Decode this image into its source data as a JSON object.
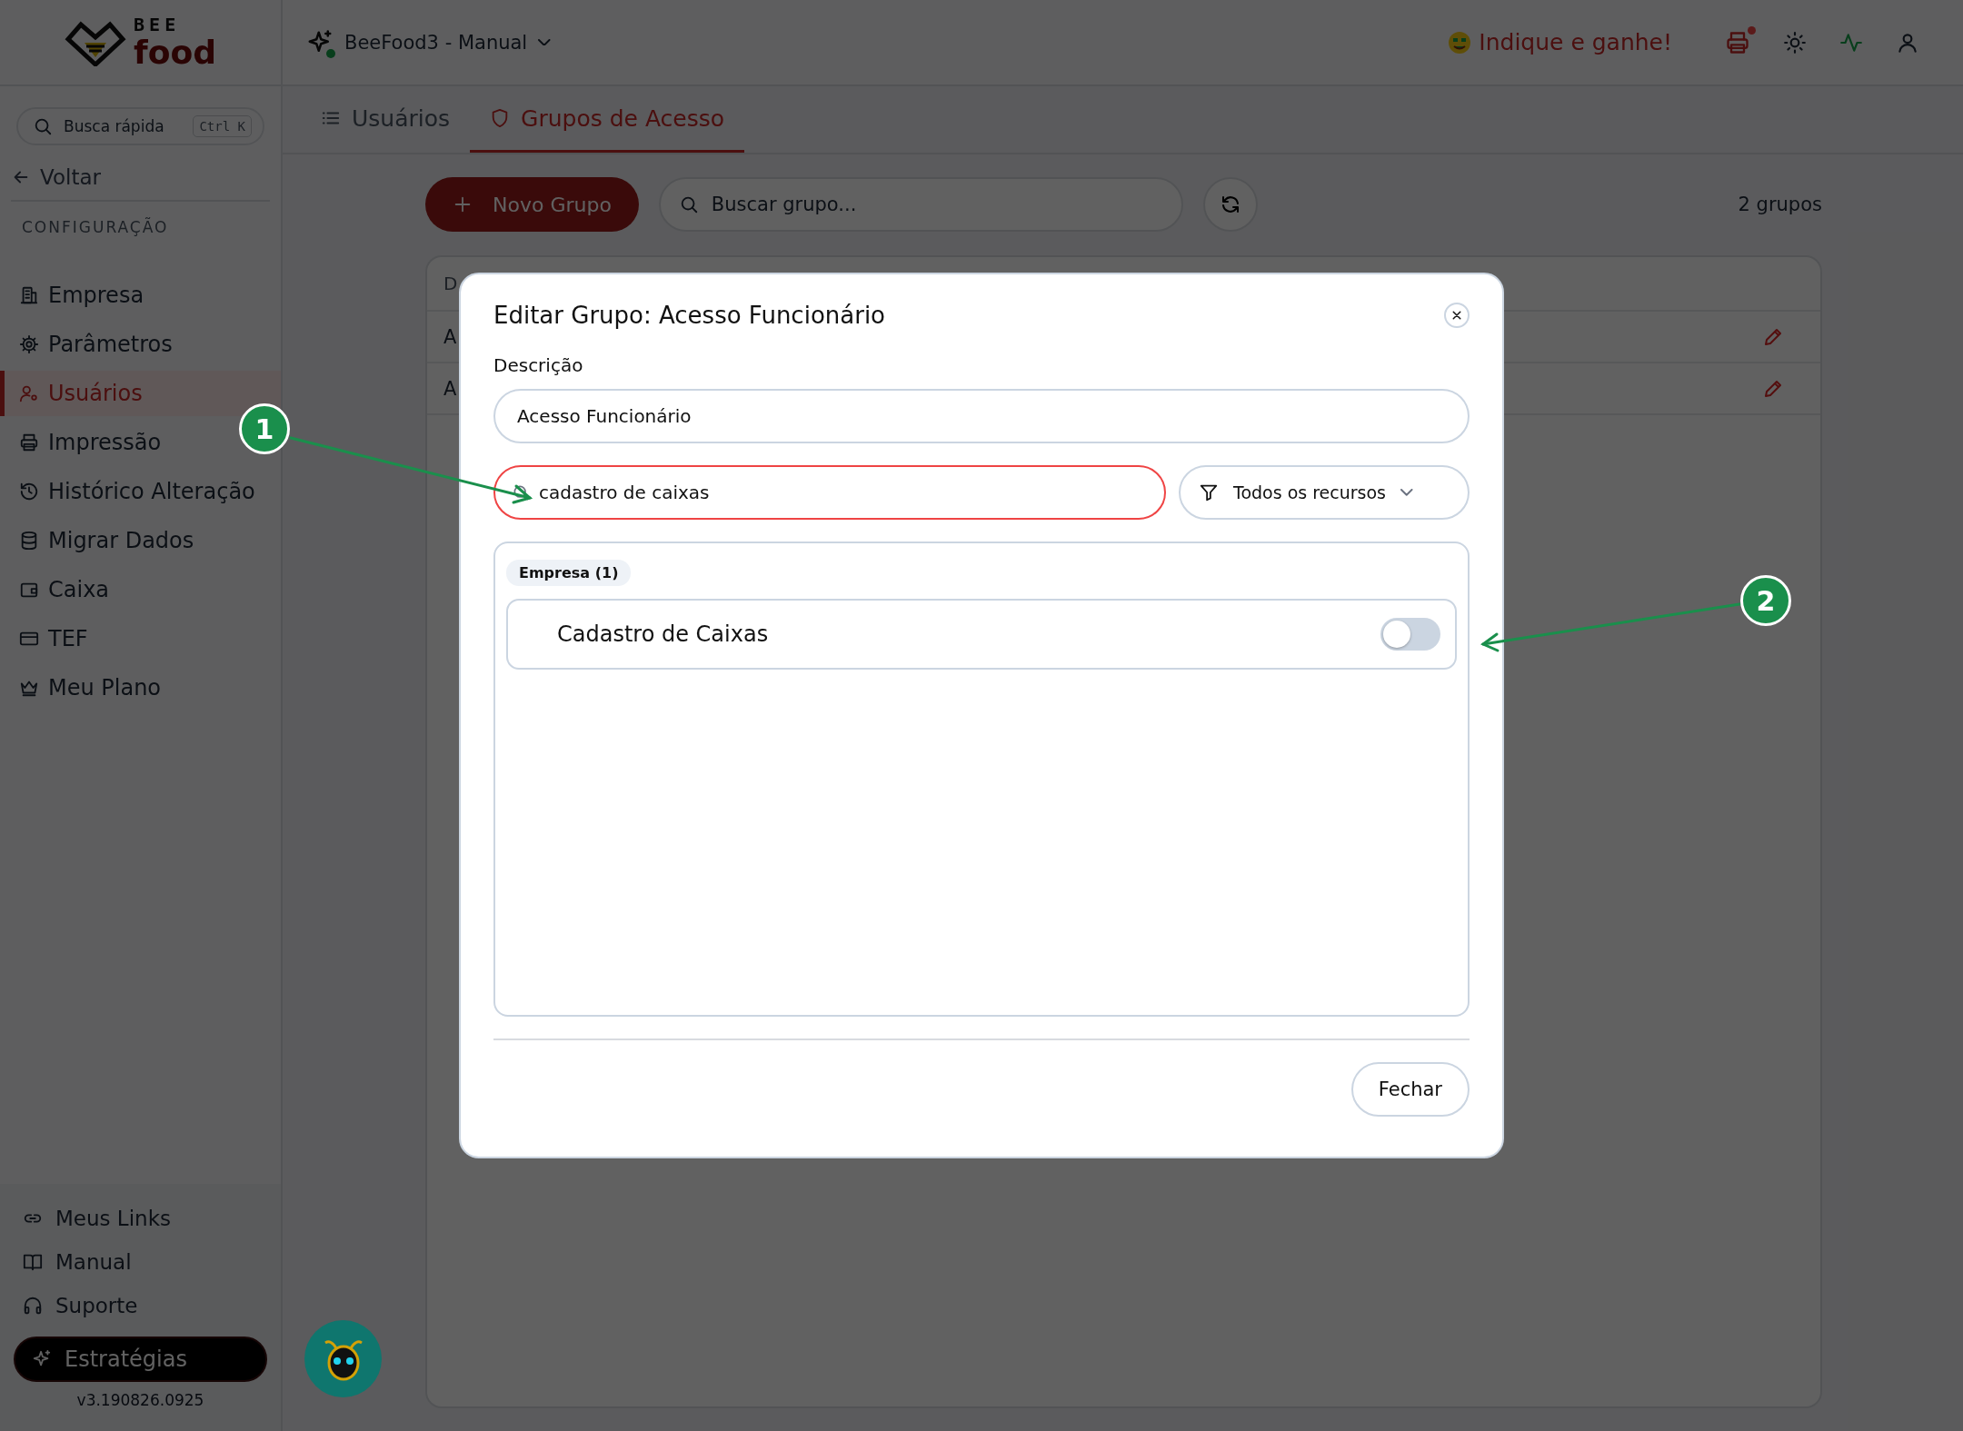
{
  "logo": {
    "line1": "BEE",
    "line2": "food"
  },
  "quick_search": {
    "placeholder": "Busca rápida",
    "shortcut": "Ctrl K"
  },
  "back": "Voltar",
  "sidebar": {
    "section": "CONFIGURAÇÃO",
    "items": [
      {
        "label": "Empresa",
        "selected": false
      },
      {
        "label": "Parâmetros",
        "selected": false
      },
      {
        "label": "Usuários",
        "selected": true
      },
      {
        "label": "Impressão",
        "selected": false
      },
      {
        "label": "Histórico Alteração",
        "selected": false
      },
      {
        "label": "Migrar Dados",
        "selected": false
      },
      {
        "label": "Caixa",
        "selected": false
      },
      {
        "label": "TEF",
        "selected": false
      },
      {
        "label": "Meu Plano",
        "selected": false
      }
    ]
  },
  "sidebar_footer": {
    "links": [
      "Meus Links",
      "Manual",
      "Suporte"
    ],
    "strategy_button": "Estratégias",
    "version": "v3.190826.0925"
  },
  "topbar": {
    "workspace": "BeeFood3 - Manual",
    "referral": "Indique e ganhe!"
  },
  "tabs": [
    {
      "label": "Usuários",
      "selected": false
    },
    {
      "label": "Grupos de Acesso",
      "selected": true
    }
  ],
  "toolbar": {
    "new_button": "Novo Grupo",
    "search_placeholder": "Buscar grupo...",
    "count": "2 grupos"
  },
  "table": {
    "header": "D",
    "rows": [
      "A",
      "A"
    ]
  },
  "modal": {
    "title": "Editar Grupo: Acesso Funcionário",
    "description_label": "Descrição",
    "description_value": "Acesso Funcionário",
    "search_value": "cadastro de caixas",
    "filter": "Todos os recursos",
    "groups": [
      {
        "label": "Empresa (1)",
        "items": [
          {
            "label": "Cadastro de Caixas",
            "on": false
          }
        ]
      }
    ],
    "close_button": "Fechar"
  },
  "annotations": [
    {
      "label": "1"
    },
    {
      "label": "2"
    }
  ]
}
